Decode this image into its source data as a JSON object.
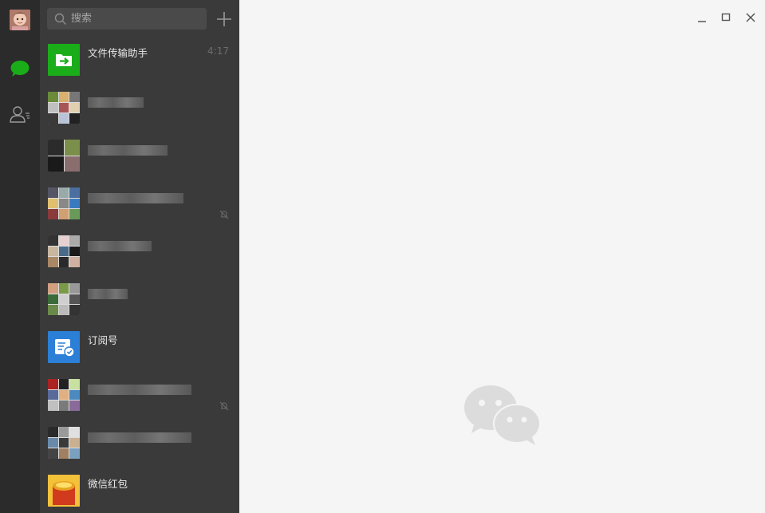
{
  "search": {
    "placeholder": "搜索"
  },
  "chats": [
    {
      "name": "文件传输助手",
      "time": "4:17",
      "icon": "file-transfer-icon",
      "icon_color": "#1aad19"
    },
    {
      "name": "",
      "icon": "group-avatar-icon"
    },
    {
      "name": "",
      "icon": "group-avatar-icon"
    },
    {
      "name": "",
      "icon": "group-avatar-icon",
      "muted": true
    },
    {
      "name": "",
      "icon": "group-avatar-icon"
    },
    {
      "name": "",
      "icon": "group-avatar-icon"
    },
    {
      "name": "订阅号",
      "icon": "subscription-icon",
      "icon_color": "#2b7fd6"
    },
    {
      "name": "",
      "icon": "group-avatar-icon",
      "muted": true
    },
    {
      "name": "",
      "icon": "group-avatar-icon"
    },
    {
      "name": "微信红包",
      "icon": "red-packet-icon",
      "icon_color": "#d23a1e"
    }
  ],
  "colors": {
    "nav_bg": "#2b2b2c",
    "list_bg": "#3a3a3a",
    "main_bg": "#f5f5f5",
    "accent": "#1aad19"
  }
}
